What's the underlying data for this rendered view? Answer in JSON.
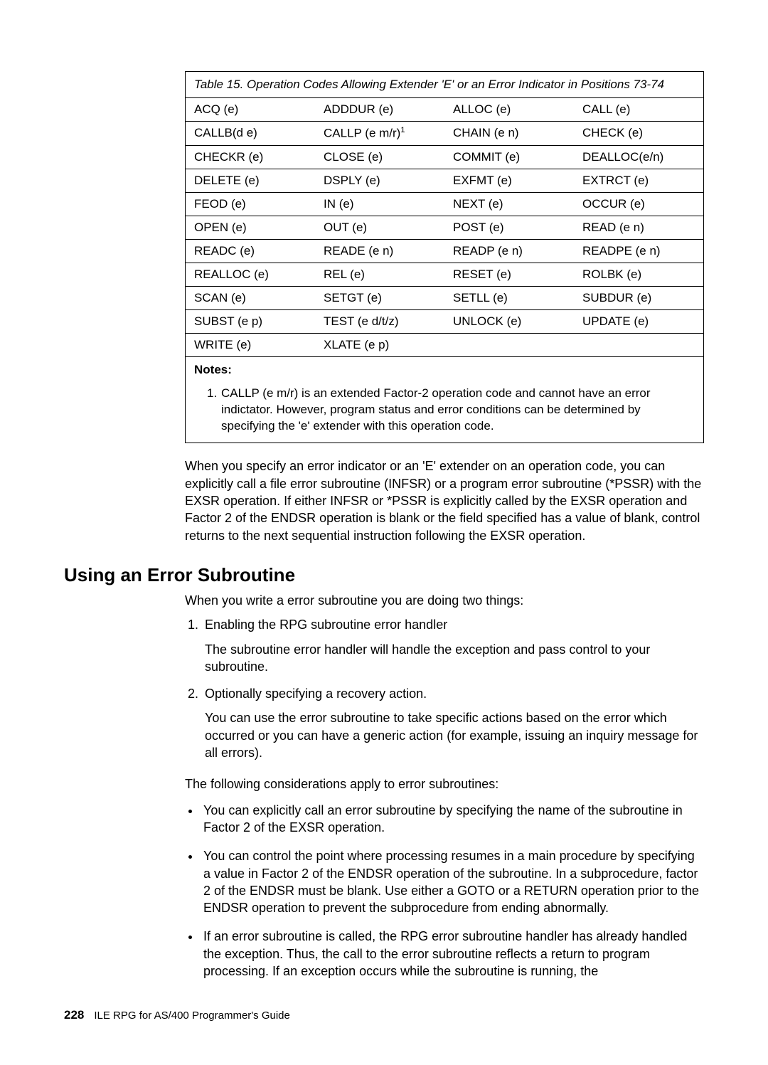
{
  "table": {
    "caption": "Table 15. Operation Codes Allowing Extender 'E' or an Error Indicator in Positions 73-74",
    "rows": [
      [
        "ACQ (e)",
        "ADDDUR (e)",
        "ALLOC (e)",
        "CALL (e)"
      ],
      [
        "CALLB(d e)",
        "CALLP (e m/r)",
        "CHAIN (e n)",
        "CHECK (e)"
      ],
      [
        "CHECKR (e)",
        "CLOSE (e)",
        "COMMIT (e)",
        "DEALLOC(e/n)"
      ],
      [
        "DELETE (e)",
        "DSPLY (e)",
        "EXFMT (e)",
        "EXTRCT (e)"
      ],
      [
        "FEOD (e)",
        "IN (e)",
        "NEXT (e)",
        "OCCUR (e)"
      ],
      [
        "OPEN (e)",
        "OUT (e)",
        "POST (e)",
        "READ (e n)"
      ],
      [
        "READC (e)",
        "READE (e n)",
        "READP (e n)",
        "READPE (e n)"
      ],
      [
        "REALLOC (e)",
        "REL (e)",
        "RESET (e)",
        "ROLBK (e)"
      ],
      [
        "SCAN (e)",
        "SETGT (e)",
        "SETLL (e)",
        "SUBDUR (e)"
      ],
      [
        "SUBST (e p)",
        "TEST (e d/t/z)",
        "UNLOCK (e)",
        "UPDATE (e)"
      ],
      [
        "WRITE (e)",
        "XLATE (e p)",
        "",
        ""
      ]
    ],
    "notes_label": "Notes:",
    "note1_num": "1.",
    "note1_text": "CALLP (e m/r) is an extended Factor-2 operation code and cannot have an error indictator. However, program status and error conditions can be determined by specifying the 'e' extender with this operation code.",
    "sup1": "1"
  },
  "para1": "When you specify an error indicator or an 'E' extender on an operation code, you can explicitly call a file error subroutine (INFSR) or a program error subroutine (*PSSR) with the EXSR operation. If either INFSR or *PSSR is explicitly called by the EXSR operation and Factor 2 of the ENDSR operation is blank or the field specified has a value of blank, control returns to the next sequential instruction following the EXSR operation.",
  "heading": "Using an Error Subroutine",
  "para2": "When you write a error subroutine you are doing two things:",
  "list1": {
    "item1": "Enabling the RPG subroutine error handler",
    "item1_sub": "The subroutine error handler will handle the exception and pass control to your subroutine.",
    "item2": "Optionally specifying a recovery action.",
    "item2_sub": "You can use the error subroutine to take specific actions based on the error which occurred or you can have a generic action (for example, issuing an inquiry message for all errors)."
  },
  "para3": "The following considerations apply to error subroutines:",
  "bullets": {
    "b1": "You can explicitly call an error subroutine by specifying the name of the subroutine in Factor 2 of the EXSR operation.",
    "b2": "You can control the point where processing resumes in a main procedure by specifying a value in Factor 2 of the ENDSR operation of the subroutine. In a subprocedure, factor 2 of the ENDSR must be blank. Use either a GOTO or a RETURN operation prior to the ENDSR operation to prevent the subprocedure from ending abnormally.",
    "b3": "If an error subroutine is called, the RPG error subroutine handler has already handled the exception. Thus, the call to the error subroutine reflects a return to program processing. If an exception occurs while the subroutine is running, the"
  },
  "footer": {
    "page": "228",
    "title": "ILE RPG for AS/400 Programmer's Guide"
  }
}
